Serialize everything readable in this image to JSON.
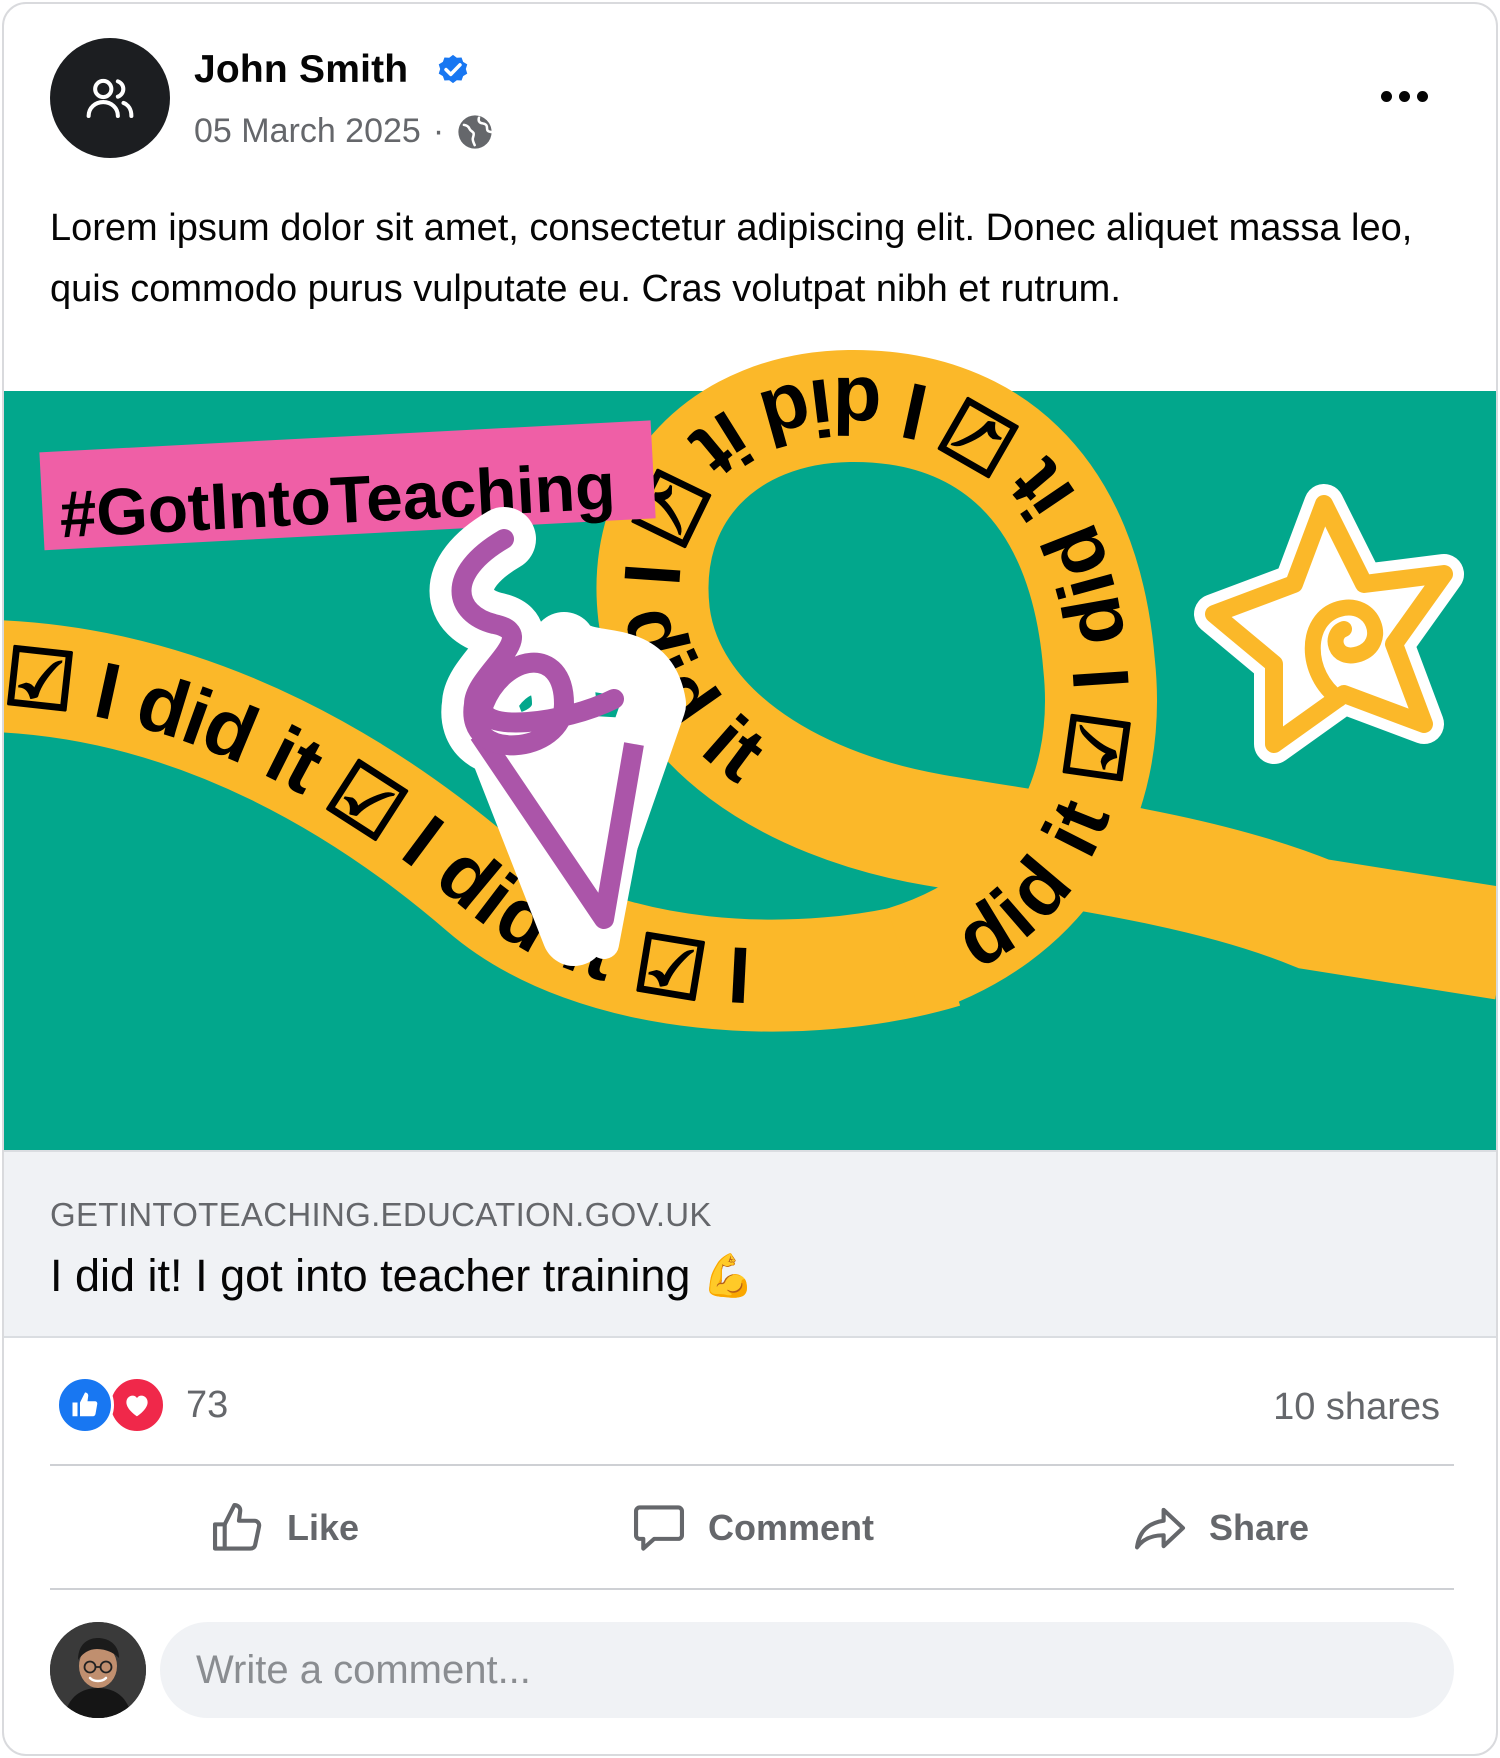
{
  "post": {
    "author": "John Smith",
    "verified_icon": "verified-badge-icon",
    "date": "05 March 2025",
    "separator": "·",
    "privacy_icon": "globe-icon",
    "more_icon": "more-options-icon",
    "text": "Lorem ipsum dolor sit amet, consectetur adipiscing elit. Donec aliquet massa leo, quis commodo purus vulputate eu. Cras volutpat nibh et rutrum."
  },
  "image": {
    "hashtag": "#GotIntoTeaching",
    "ribbon_text": "I did it",
    "colors": {
      "background": "#02a78c",
      "ribbon": "#fbb829",
      "hashtag_bg": "#ef5fa6",
      "swirl": "#ab55a9"
    }
  },
  "link_preview": {
    "domain": "GETINTOTEACHING.EDUCATION.GOV.UK",
    "title": "I did it! I got into teacher training",
    "emoji": "💪"
  },
  "stats": {
    "reaction_icons": [
      "like-reaction-icon",
      "love-reaction-icon"
    ],
    "reaction_count": "73",
    "shares": "10 shares"
  },
  "actions": {
    "like": "Like",
    "comment": "Comment",
    "share": "Share"
  },
  "comment_box": {
    "placeholder": "Write a comment..."
  },
  "colors": {
    "accent": "#1877f2",
    "love": "#f0284a",
    "muted_text": "#65676b"
  }
}
